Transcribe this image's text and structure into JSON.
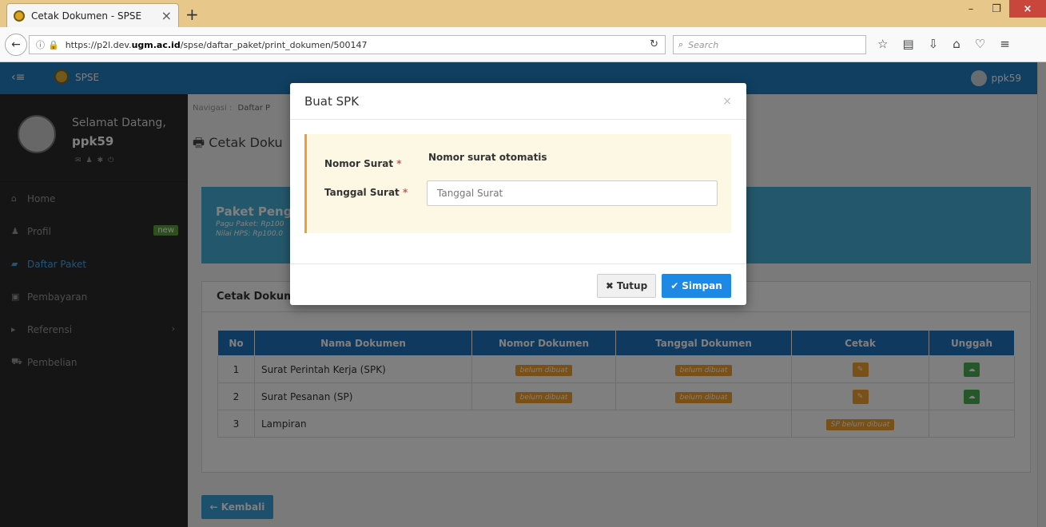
{
  "browser": {
    "tab_title": "Cetak Dokumen - SPSE",
    "url_prefix": "https://p2l.dev.",
    "url_domain": "ugm.ac.id",
    "url_path": "/spse/daftar_paket/print_dokumen/500147",
    "search_placeholder": "Search"
  },
  "header": {
    "brand": "SPSE",
    "user": "ppk59"
  },
  "sidebar": {
    "welcome": "Selamat Datang,",
    "username": "ppk59",
    "items": [
      {
        "label": "Home"
      },
      {
        "label": "Profil",
        "badge": "new"
      },
      {
        "label": "Daftar Paket"
      },
      {
        "label": "Pembayaran"
      },
      {
        "label": "Referensi"
      },
      {
        "label": "Pembelian"
      }
    ]
  },
  "content": {
    "breadcrumb_label": "Navigasi :",
    "breadcrumb_current": "Daftar P",
    "page_title": "Cetak Doku",
    "package_title": "Paket Peng",
    "pagu": "Pagu Paket: Rp100",
    "hps": "Nilai HPS: Rp100.0",
    "panel_title": "Cetak Dokum",
    "table": {
      "headers": [
        "No",
        "Nama Dokumen",
        "Nomor Dokumen",
        "Tanggal Dokumen",
        "Cetak",
        "Unggah"
      ],
      "rows": [
        {
          "no": "1",
          "nama": "Surat Perintah Kerja (SPK)",
          "nomor": "belum dibuat",
          "tanggal": "belum dibuat"
        },
        {
          "no": "2",
          "nama": "Surat Pesanan (SP)",
          "nomor": "belum dibuat",
          "tanggal": "belum dibuat"
        },
        {
          "no": "3",
          "nama": "Lampiran",
          "cetak": "SP belum dibuat"
        }
      ]
    },
    "back_label": "Kembali"
  },
  "modal": {
    "title": "Buat SPK",
    "nomor_label": "Nomor Surat",
    "nomor_value": "Nomor surat otomatis",
    "tanggal_label": "Tanggal Surat",
    "tanggal_placeholder": "Tanggal Surat",
    "required_mark": "*",
    "tutup_label": "Tutup",
    "simpan_label": "Simpan"
  }
}
